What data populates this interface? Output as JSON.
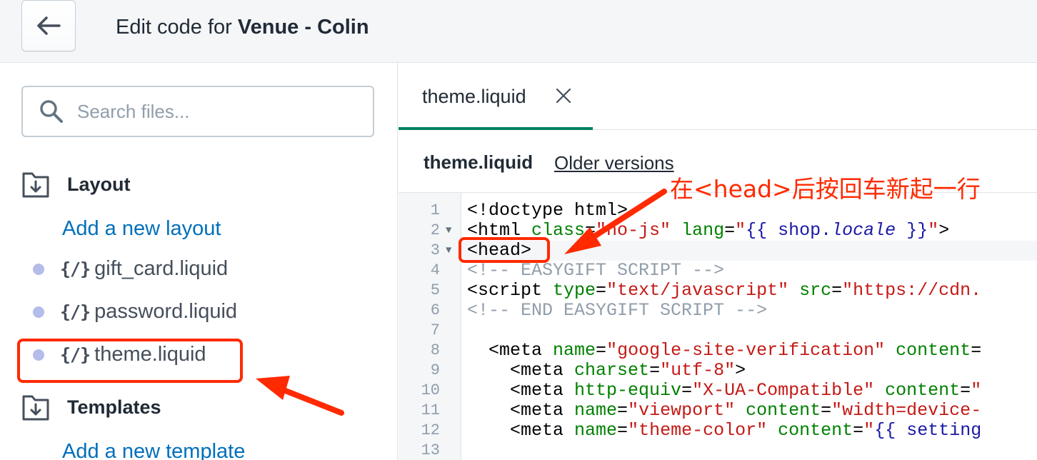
{
  "header": {
    "title_prefix": "Edit code for ",
    "title_theme": "Venue - Colin",
    "back_icon": "arrow-left-icon"
  },
  "sidebar": {
    "search_placeholder": "Search files...",
    "layout_section": {
      "label": "Layout",
      "add_link": "Add a new layout",
      "files": [
        "gift_card.liquid",
        "password.liquid",
        "theme.liquid"
      ]
    },
    "templates_section": {
      "label": "Templates",
      "add_link": "Add a new template"
    },
    "liquid_icon_glyph": "{/}"
  },
  "editor": {
    "tab_label": "theme.liquid",
    "file_name": "theme.liquid",
    "older_versions": "Older versions",
    "line_numbers": [
      "1",
      "2",
      "3",
      "4",
      "5",
      "6",
      "7",
      "8",
      "9",
      "10",
      "11",
      "12",
      "13"
    ]
  },
  "annotation": {
    "text": "在<head>后按回车新起一行"
  },
  "colors": {
    "accent_green": "#008060",
    "link_blue": "#006fbb",
    "annotation_red": "#ff2a00"
  }
}
